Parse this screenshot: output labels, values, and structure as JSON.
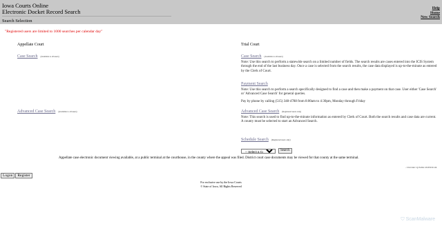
{
  "header": {
    "title_line1": "Iowa Courts Online",
    "title_line2": "Electronic Docket Record Search",
    "subtitle": "Search Selection",
    "links": [
      "Help",
      "Home",
      "New Search"
    ]
  },
  "notice": "\"Registered users are limited to 1000 searches per calendar day\"",
  "appellate": {
    "heading": "Appellate Court",
    "case_search_label": "Case Search",
    "case_search_note": "(Available to all users)",
    "advanced_label": "Advanced Case Search",
    "advanced_note": "(Available to all users)"
  },
  "trial": {
    "heading": "Trial Court",
    "case_search_label": "Case Search",
    "case_search_note": "(Available to all users)",
    "case_search_desc": "Note:  Use this search to perform a statewide search on a limited number of fields. The search results are cases entered into the ICIS System through the end of the last business day. Once a case is selected from the search results, the case data displayed is up-to-the-minute as entered by the Clerk of Court.",
    "payment_label": "Payment Search",
    "payment_desc": "Note:  Use this search to perform a search specifically designed to find a case and then make a payment on that case. User either 'Case Search' or 'Advanced Case Search' for general queries.",
    "phone": "Pay by phone by calling (515) 348-4788 from 8:00am to 4:30pm, Monday through Friday",
    "advanced_label": "Advanced Case Search",
    "advanced_note": "(Registered users only)",
    "advanced_desc": "Note:  This search is used to find up-to-the-minute information as entered by Clerk of Court. Both the search results and case data are current. A county must be selected to start an Advanced Search.",
    "schedule_label": "Schedule Search",
    "schedule_note": "(Registered users only)",
    "country_selected": "-- Select a Country --",
    "search_button": "Search"
  },
  "footer": {
    "message": "Appellate case electronic document viewing available, at a public terminal at the courthouse, in the county where the appeal was filed. District court case documents may be viewed for that county at the same terminal.",
    "version": "- Chrvidev Q Public.DvEtDCt4L",
    "logon": "Logon",
    "register": "Register",
    "exclusive": "For exclusive use by the Iowa Courts",
    "copyright": "© State of Iowa,  All Rights Reserved"
  },
  "watermark": "ScanMalware"
}
